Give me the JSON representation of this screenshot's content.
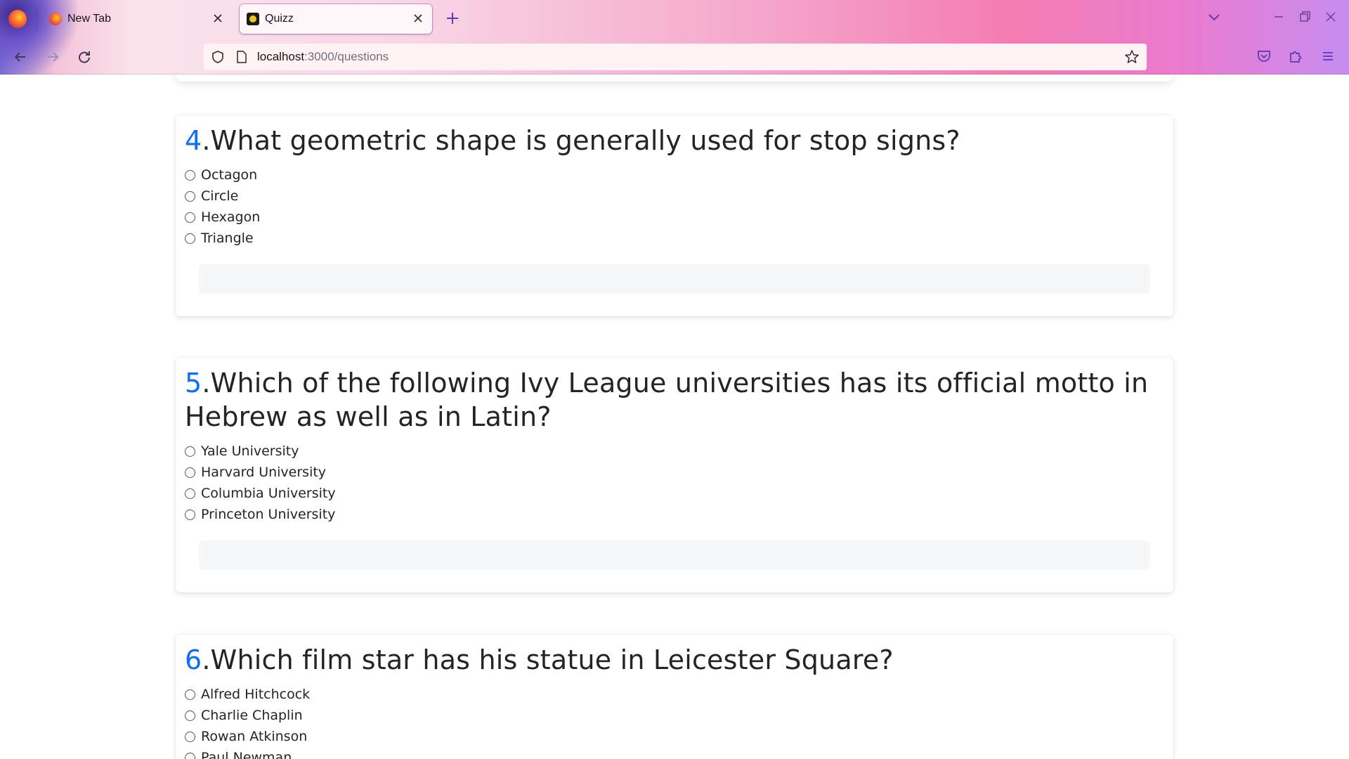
{
  "browser": {
    "tabs": [
      {
        "title": "New Tab",
        "active": false
      },
      {
        "title": "Quizz",
        "active": true
      }
    ],
    "url": {
      "host": "localhost",
      "path": ":3000/questions"
    },
    "colors": {
      "accent": "#5b3bb0",
      "link_blue": "#0d6efd"
    }
  },
  "icons": {
    "firefox": "firefox-logo-icon",
    "close": "close-icon",
    "new_tab": "plus-icon",
    "tab_list": "chevron-down-icon",
    "minimize": "minimize-icon",
    "restore": "restore-icon",
    "window_close": "window-close-icon",
    "back": "arrow-left-icon",
    "forward": "arrow-right-icon",
    "reload": "reload-icon",
    "shield": "shield-icon",
    "page": "page-icon",
    "bookmark": "star-icon",
    "pocket": "pocket-icon",
    "extensions": "puzzle-icon",
    "menu": "hamburger-icon"
  },
  "questions": [
    {
      "number": "4",
      "text": ".What geometric shape is generally used for stop signs?",
      "options": [
        "Octagon",
        "Circle",
        "Hexagon",
        "Triangle"
      ]
    },
    {
      "number": "5",
      "text": ".Which of the following Ivy League universities has its official motto in Hebrew as well as in Latin?",
      "options": [
        "Yale University",
        "Harvard University",
        "Columbia University",
        "Princeton University"
      ]
    },
    {
      "number": "6",
      "text": ".Which film star has his statue in Leicester Square?",
      "options": [
        "Alfred Hitchcock",
        "Charlie Chaplin",
        "Rowan Atkinson",
        "Paul Newman"
      ]
    }
  ]
}
